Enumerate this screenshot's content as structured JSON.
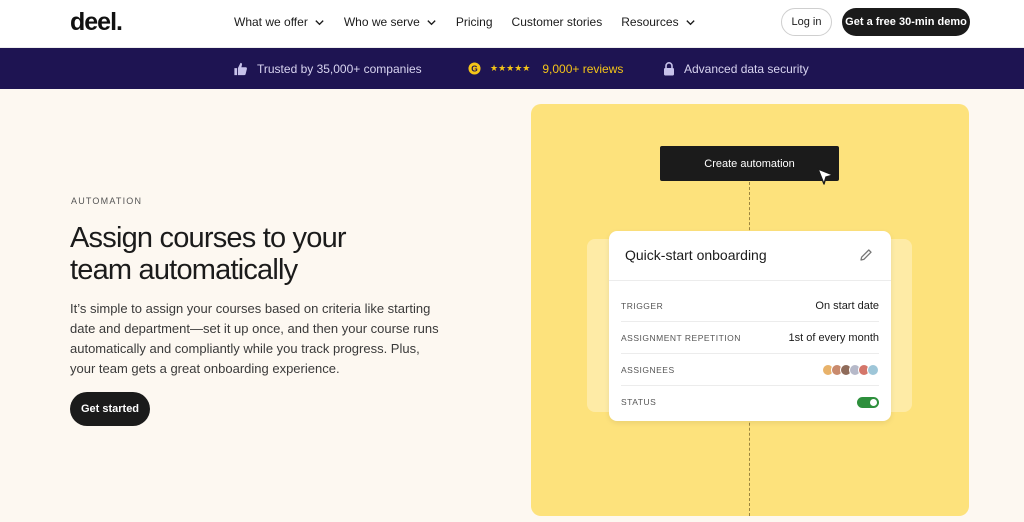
{
  "nav": {
    "logo": "deel.",
    "links": [
      {
        "label": "What we offer",
        "has_dropdown": true
      },
      {
        "label": "Who we serve",
        "has_dropdown": true
      },
      {
        "label": "Pricing",
        "has_dropdown": false
      },
      {
        "label": "Customer stories",
        "has_dropdown": false
      },
      {
        "label": "Resources",
        "has_dropdown": true
      }
    ],
    "login_label": "Log in",
    "demo_label": "Get a free 30-min demo"
  },
  "trust_bar": {
    "trusted": "Trusted by 35,000+ companies",
    "stars": "★★★★★",
    "reviews": "9,000+ reviews",
    "security": "Advanced data security"
  },
  "hero": {
    "eyebrow": "AUTOMATION",
    "headline": "Assign courses to your team automatically",
    "body": "It’s simple to assign your courses based on criteria like starting date and department—set it up once, and then your course runs automatically and compliantly while you track progress. Plus, your team gets a great onboarding experience.",
    "cta_label": "Get started"
  },
  "automation_card": {
    "create_button": "Create automation",
    "title": "Quick-start onboarding",
    "rows": [
      {
        "label": "TRIGGER",
        "value": "On start date"
      },
      {
        "label": "ASSIGNMENT REPETITION",
        "value": "1st of every month"
      },
      {
        "label": "ASSIGNEES",
        "value": ""
      },
      {
        "label": "STATUS",
        "value": ""
      }
    ],
    "status_on": true
  },
  "colors": {
    "trust_bar_bg": "#1e1452",
    "panel_bg": "#fde27c",
    "accent_dark": "#1b1b1b",
    "toggle_on": "#2d8f3c",
    "star_color": "#f5c518"
  }
}
